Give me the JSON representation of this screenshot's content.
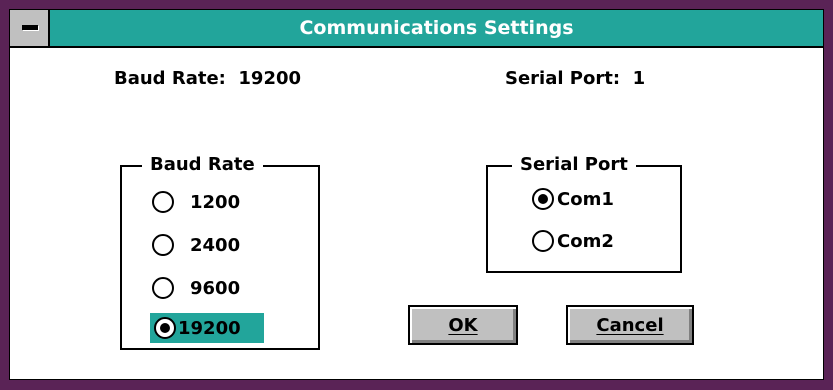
{
  "window": {
    "title": "Communications Settings",
    "colors": {
      "titlebar": "#22a59b",
      "frame": "#5a2356",
      "selection": "#22a59b",
      "button_face": "#c0c0c0"
    }
  },
  "status": {
    "baud_label": "Baud Rate:",
    "baud_value": "19200",
    "port_label": "Serial Port:",
    "port_value": "1"
  },
  "baud_group": {
    "label": "Baud Rate",
    "options": [
      {
        "label": "1200",
        "checked": false
      },
      {
        "label": "2400",
        "checked": false
      },
      {
        "label": "9600",
        "checked": false
      },
      {
        "label": "19200",
        "checked": true
      }
    ]
  },
  "port_group": {
    "label": "Serial Port",
    "options": [
      {
        "label": "Com1",
        "checked": true
      },
      {
        "label": "Com2",
        "checked": false
      }
    ]
  },
  "buttons": {
    "ok": "OK",
    "cancel": "Cancel"
  }
}
